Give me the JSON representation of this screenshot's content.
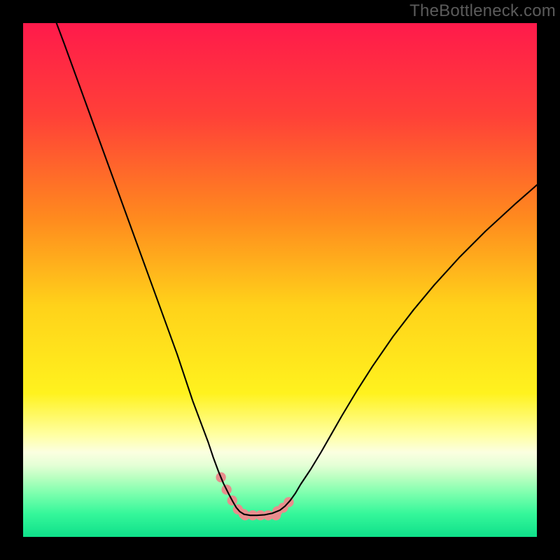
{
  "watermark": "TheBottleneck.com",
  "plot": {
    "outer_size": 800,
    "border": 33,
    "inner_left": 33,
    "inner_top": 33,
    "inner_width": 734,
    "inner_height": 734
  },
  "gradient": {
    "stops": [
      {
        "offset": 0.0,
        "color": "#ff1a4b"
      },
      {
        "offset": 0.18,
        "color": "#ff4038"
      },
      {
        "offset": 0.38,
        "color": "#ff8a1e"
      },
      {
        "offset": 0.55,
        "color": "#ffd21a"
      },
      {
        "offset": 0.72,
        "color": "#fff21e"
      },
      {
        "offset": 0.8,
        "color": "#ffffa0"
      },
      {
        "offset": 0.835,
        "color": "#fbffe0"
      },
      {
        "offset": 0.86,
        "color": "#e5ffd6"
      },
      {
        "offset": 0.885,
        "color": "#b8ffc0"
      },
      {
        "offset": 0.915,
        "color": "#7dffae"
      },
      {
        "offset": 0.955,
        "color": "#35f79a"
      },
      {
        "offset": 1.0,
        "color": "#0fe08a"
      }
    ]
  },
  "chart_data": {
    "type": "line",
    "title": "",
    "xlabel": "",
    "ylabel": "",
    "xlim": [
      0,
      100
    ],
    "ylim": [
      0,
      100
    ],
    "legend": false,
    "grid": false,
    "x": [
      6.5,
      8,
      10,
      12,
      14,
      16,
      18,
      20,
      22,
      24,
      26,
      28,
      30,
      31.5,
      33,
      34.5,
      36,
      37,
      38,
      39,
      40,
      40.8,
      41.5,
      42.2,
      43,
      44.2,
      45.5,
      47,
      48.5,
      50,
      51,
      52,
      53,
      54,
      56,
      58,
      60,
      62,
      65,
      68,
      72,
      76,
      80,
      85,
      90,
      96,
      100
    ],
    "values": [
      100,
      96,
      90.5,
      85,
      79.5,
      74,
      68.5,
      63,
      57.5,
      52,
      46.5,
      41,
      35.5,
      31,
      26.5,
      22.5,
      18.5,
      15.5,
      12.8,
      10.4,
      8.4,
      6.9,
      5.7,
      4.9,
      4.4,
      4.2,
      4.2,
      4.3,
      4.6,
      5.2,
      6.0,
      7.1,
      8.5,
      10.2,
      13.2,
      16.5,
      20.0,
      23.5,
      28.5,
      33.2,
      39.0,
      44.2,
      49.0,
      54.5,
      59.5,
      65.0,
      68.5
    ],
    "annotations": [
      {
        "kind": "highlight",
        "shape": "L",
        "x_range": [
          39,
          52
        ],
        "y_range": [
          3.8,
          11.5
        ],
        "color": "#e88d8d"
      }
    ]
  }
}
